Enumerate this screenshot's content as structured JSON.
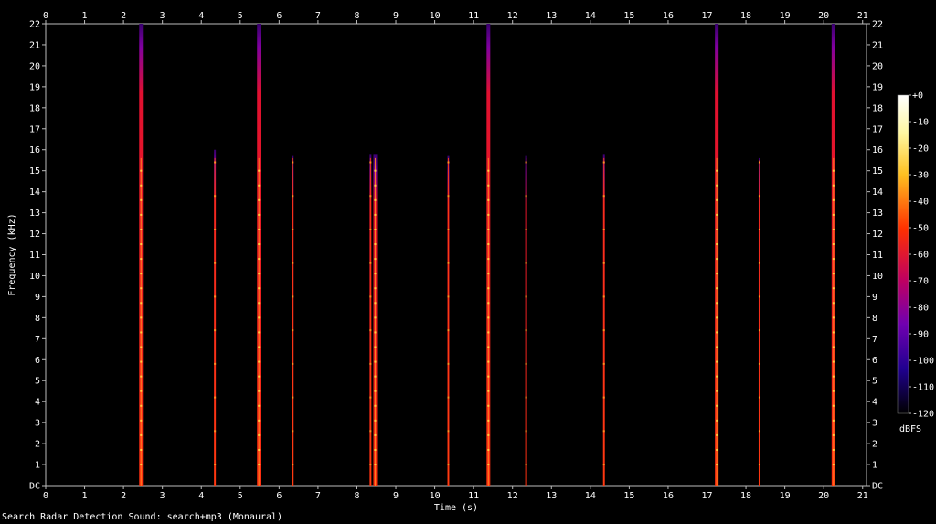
{
  "chart_data": {
    "type": "heatmap",
    "title": "",
    "xlabel": "Time (s)",
    "ylabel": "Frequency (kHz)",
    "xlim": [
      0,
      21.1
    ],
    "ylim": [
      0,
      22
    ],
    "x_ticks": [
      "0",
      "1",
      "2",
      "3",
      "4",
      "5",
      "6",
      "7",
      "8",
      "9",
      "10",
      "11",
      "12",
      "13",
      "14",
      "15",
      "16",
      "17",
      "18",
      "19",
      "20",
      "21"
    ],
    "y_ticks": [
      "DC",
      "1",
      "2",
      "3",
      "4",
      "5",
      "6",
      "7",
      "8",
      "9",
      "10",
      "11",
      "12",
      "13",
      "14",
      "15",
      "16",
      "17",
      "18",
      "19",
      "20",
      "21",
      "22"
    ],
    "colorbar": {
      "label": "dBFS",
      "min": -120,
      "max": 0,
      "ticks": [
        "+0",
        "-10",
        "-20",
        "-30",
        "-40",
        "-50",
        "-60",
        "-70",
        "-80",
        "-90",
        "-100",
        "-110",
        "-120"
      ]
    },
    "background_color": "#000000",
    "pulses": [
      {
        "t": 2.45,
        "top_khz": 22,
        "peak_khz": 15.6,
        "level_dbfs": -45
      },
      {
        "t": 4.35,
        "top_khz": 16.0,
        "peak_khz": 15.6,
        "level_dbfs": -55
      },
      {
        "t": 5.48,
        "top_khz": 22,
        "peak_khz": 15.6,
        "level_dbfs": -45
      },
      {
        "t": 6.35,
        "top_khz": 15.7,
        "peak_khz": 15.6,
        "level_dbfs": -55
      },
      {
        "t": 8.35,
        "top_khz": 15.8,
        "peak_khz": 15.6,
        "level_dbfs": -55
      },
      {
        "t": 8.47,
        "top_khz": 15.8,
        "peak_khz": 15.6,
        "level_dbfs": -48
      },
      {
        "t": 10.35,
        "top_khz": 15.7,
        "peak_khz": 15.6,
        "level_dbfs": -55
      },
      {
        "t": 11.38,
        "top_khz": 22,
        "peak_khz": 15.6,
        "level_dbfs": -45
      },
      {
        "t": 12.35,
        "top_khz": 15.7,
        "peak_khz": 15.6,
        "level_dbfs": -55
      },
      {
        "t": 14.35,
        "top_khz": 15.8,
        "peak_khz": 15.6,
        "level_dbfs": -50
      },
      {
        "t": 17.25,
        "top_khz": 22,
        "peak_khz": 15.6,
        "level_dbfs": -45
      },
      {
        "t": 18.35,
        "top_khz": 15.6,
        "peak_khz": 15.5,
        "level_dbfs": -55
      },
      {
        "t": 20.25,
        "top_khz": 22,
        "peak_khz": 15.6,
        "level_dbfs": -45
      }
    ]
  },
  "footer": {
    "caption": "Search Radar Detection Sound: search+mp3 (Monaural)"
  }
}
